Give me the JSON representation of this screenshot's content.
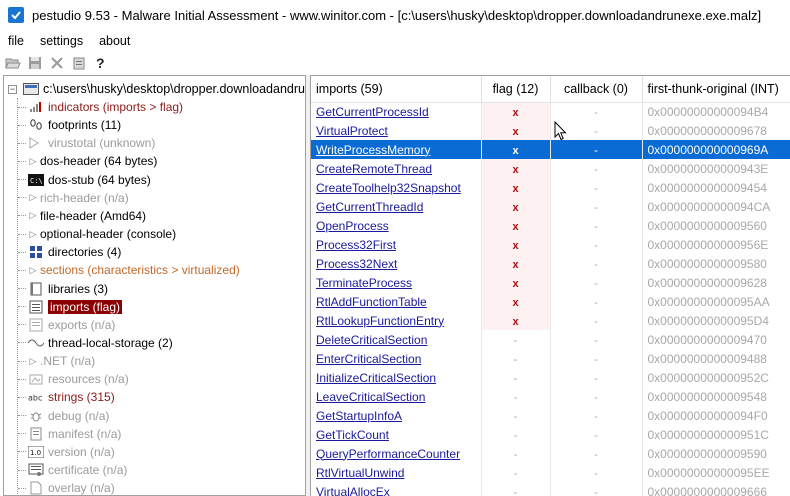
{
  "window": {
    "title": "pestudio 9.53 - Malware Initial Assessment - www.winitor.com - [c:\\users\\husky\\desktop\\dropper.downloadandrunexe.exe.malz]"
  },
  "menu": [
    "file",
    "settings",
    "about"
  ],
  "toolbar": [
    "open-icon",
    "save-icon",
    "close-icon",
    "clipboard-icon",
    "help-icon"
  ],
  "tree": {
    "root_label": "c:\\users\\husky\\desktop\\dropper.downloadandru",
    "items": [
      {
        "label": "indicators (imports > flag)",
        "icon": "indicators-icon",
        "style": "red",
        "chevron": false
      },
      {
        "label": "footprints (11)",
        "icon": "footprints-icon",
        "style": "black",
        "chevron": false
      },
      {
        "label": "virustotal (unknown)",
        "icon": "virustotal-icon",
        "style": "gray",
        "chevron": false
      },
      {
        "label": "dos-header (64 bytes)",
        "icon": "",
        "style": "black",
        "chevron": true
      },
      {
        "label": "dos-stub (64 bytes)",
        "icon": "dos-stub-icon",
        "style": "black",
        "chevron": false
      },
      {
        "label": "rich-header (n/a)",
        "icon": "",
        "style": "gray",
        "chevron": true
      },
      {
        "label": "file-header (Amd64)",
        "icon": "",
        "style": "black",
        "chevron": true
      },
      {
        "label": "optional-header (console)",
        "icon": "",
        "style": "black",
        "chevron": true
      },
      {
        "label": "directories (4)",
        "icon": "directories-icon",
        "style": "black",
        "chevron": false
      },
      {
        "label": "sections (characteristics > virtualized)",
        "icon": "",
        "style": "orange",
        "chevron": true
      },
      {
        "label": "libraries (3)",
        "icon": "libraries-icon",
        "style": "black",
        "chevron": false
      },
      {
        "label": "imports (flag)",
        "icon": "imports-icon",
        "style": "selected",
        "chevron": false
      },
      {
        "label": "exports (n/a)",
        "icon": "exports-icon",
        "style": "gray",
        "chevron": false
      },
      {
        "label": "thread-local-storage (2)",
        "icon": "tls-icon",
        "style": "black",
        "chevron": false
      },
      {
        "label": ".NET (n/a)",
        "icon": "",
        "style": "gray",
        "chevron": true
      },
      {
        "label": "resources (n/a)",
        "icon": "resources-icon",
        "style": "gray",
        "chevron": false
      },
      {
        "label": "strings (315)",
        "icon": "strings-icon",
        "style": "red",
        "chevron": false
      },
      {
        "label": "debug (n/a)",
        "icon": "debug-icon",
        "style": "gray",
        "chevron": false
      },
      {
        "label": "manifest (n/a)",
        "icon": "manifest-icon",
        "style": "gray",
        "chevron": false
      },
      {
        "label": "version (n/a)",
        "icon": "version-icon",
        "style": "gray",
        "chevron": false
      },
      {
        "label": "certificate (n/a)",
        "icon": "certificate-icon",
        "style": "gray",
        "chevron": false
      },
      {
        "label": "overlay (n/a)",
        "icon": "overlay-icon",
        "style": "gray",
        "chevron": false
      }
    ]
  },
  "grid": {
    "columns": [
      "imports (59)",
      "flag (12)",
      "callback (0)",
      "first-thunk-original (INT)"
    ],
    "selected_index": 2,
    "rows": [
      {
        "name": "GetCurrentProcessId",
        "flag": "x",
        "callback": "-",
        "thunk": "0x00000000000094B4"
      },
      {
        "name": "VirtualProtect",
        "flag": "x",
        "callback": "-",
        "thunk": "0x0000000000009678"
      },
      {
        "name": "WriteProcessMemory",
        "flag": "x",
        "callback": "-",
        "thunk": "0x000000000000969A"
      },
      {
        "name": "CreateRemoteThread",
        "flag": "x",
        "callback": "-",
        "thunk": "0x000000000000943E"
      },
      {
        "name": "CreateToolhelp32Snapshot",
        "flag": "x",
        "callback": "-",
        "thunk": "0x0000000000009454"
      },
      {
        "name": "GetCurrentThreadId",
        "flag": "x",
        "callback": "-",
        "thunk": "0x00000000000094CA"
      },
      {
        "name": "OpenProcess",
        "flag": "x",
        "callback": "-",
        "thunk": "0x0000000000009560"
      },
      {
        "name": "Process32First",
        "flag": "x",
        "callback": "-",
        "thunk": "0x000000000000956E"
      },
      {
        "name": "Process32Next",
        "flag": "x",
        "callback": "-",
        "thunk": "0x0000000000009580"
      },
      {
        "name": "TerminateProcess",
        "flag": "x",
        "callback": "-",
        "thunk": "0x0000000000009628"
      },
      {
        "name": "RtlAddFunctionTable",
        "flag": "x",
        "callback": "-",
        "thunk": "0x00000000000095AA"
      },
      {
        "name": "RtlLookupFunctionEntry",
        "flag": "x",
        "callback": "-",
        "thunk": "0x00000000000095D4"
      },
      {
        "name": "DeleteCriticalSection",
        "flag": "-",
        "callback": "-",
        "thunk": "0x0000000000009470"
      },
      {
        "name": "EnterCriticalSection",
        "flag": "-",
        "callback": "-",
        "thunk": "0x0000000000009488"
      },
      {
        "name": "InitializeCriticalSection",
        "flag": "-",
        "callback": "-",
        "thunk": "0x000000000000952C"
      },
      {
        "name": "LeaveCriticalSection",
        "flag": "-",
        "callback": "-",
        "thunk": "0x0000000000009548"
      },
      {
        "name": "GetStartupInfoA",
        "flag": "-",
        "callback": "-",
        "thunk": "0x00000000000094F0"
      },
      {
        "name": "GetTickCount",
        "flag": "-",
        "callback": "-",
        "thunk": "0x000000000000951C"
      },
      {
        "name": "QueryPerformanceCounter",
        "flag": "-",
        "callback": "-",
        "thunk": "0x0000000000009590"
      },
      {
        "name": "RtlVirtualUnwind",
        "flag": "-",
        "callback": "-",
        "thunk": "0x00000000000095EE"
      },
      {
        "name": "VirtualAllocEx",
        "flag": "-",
        "callback": "-",
        "thunk": "0x0000000000009666"
      }
    ]
  },
  "colors": {
    "selection": "#0a6bd4",
    "flag_red": "#b01010",
    "tree_selected_bg": "#8b0000",
    "link_blue": "#1a1a9c"
  }
}
